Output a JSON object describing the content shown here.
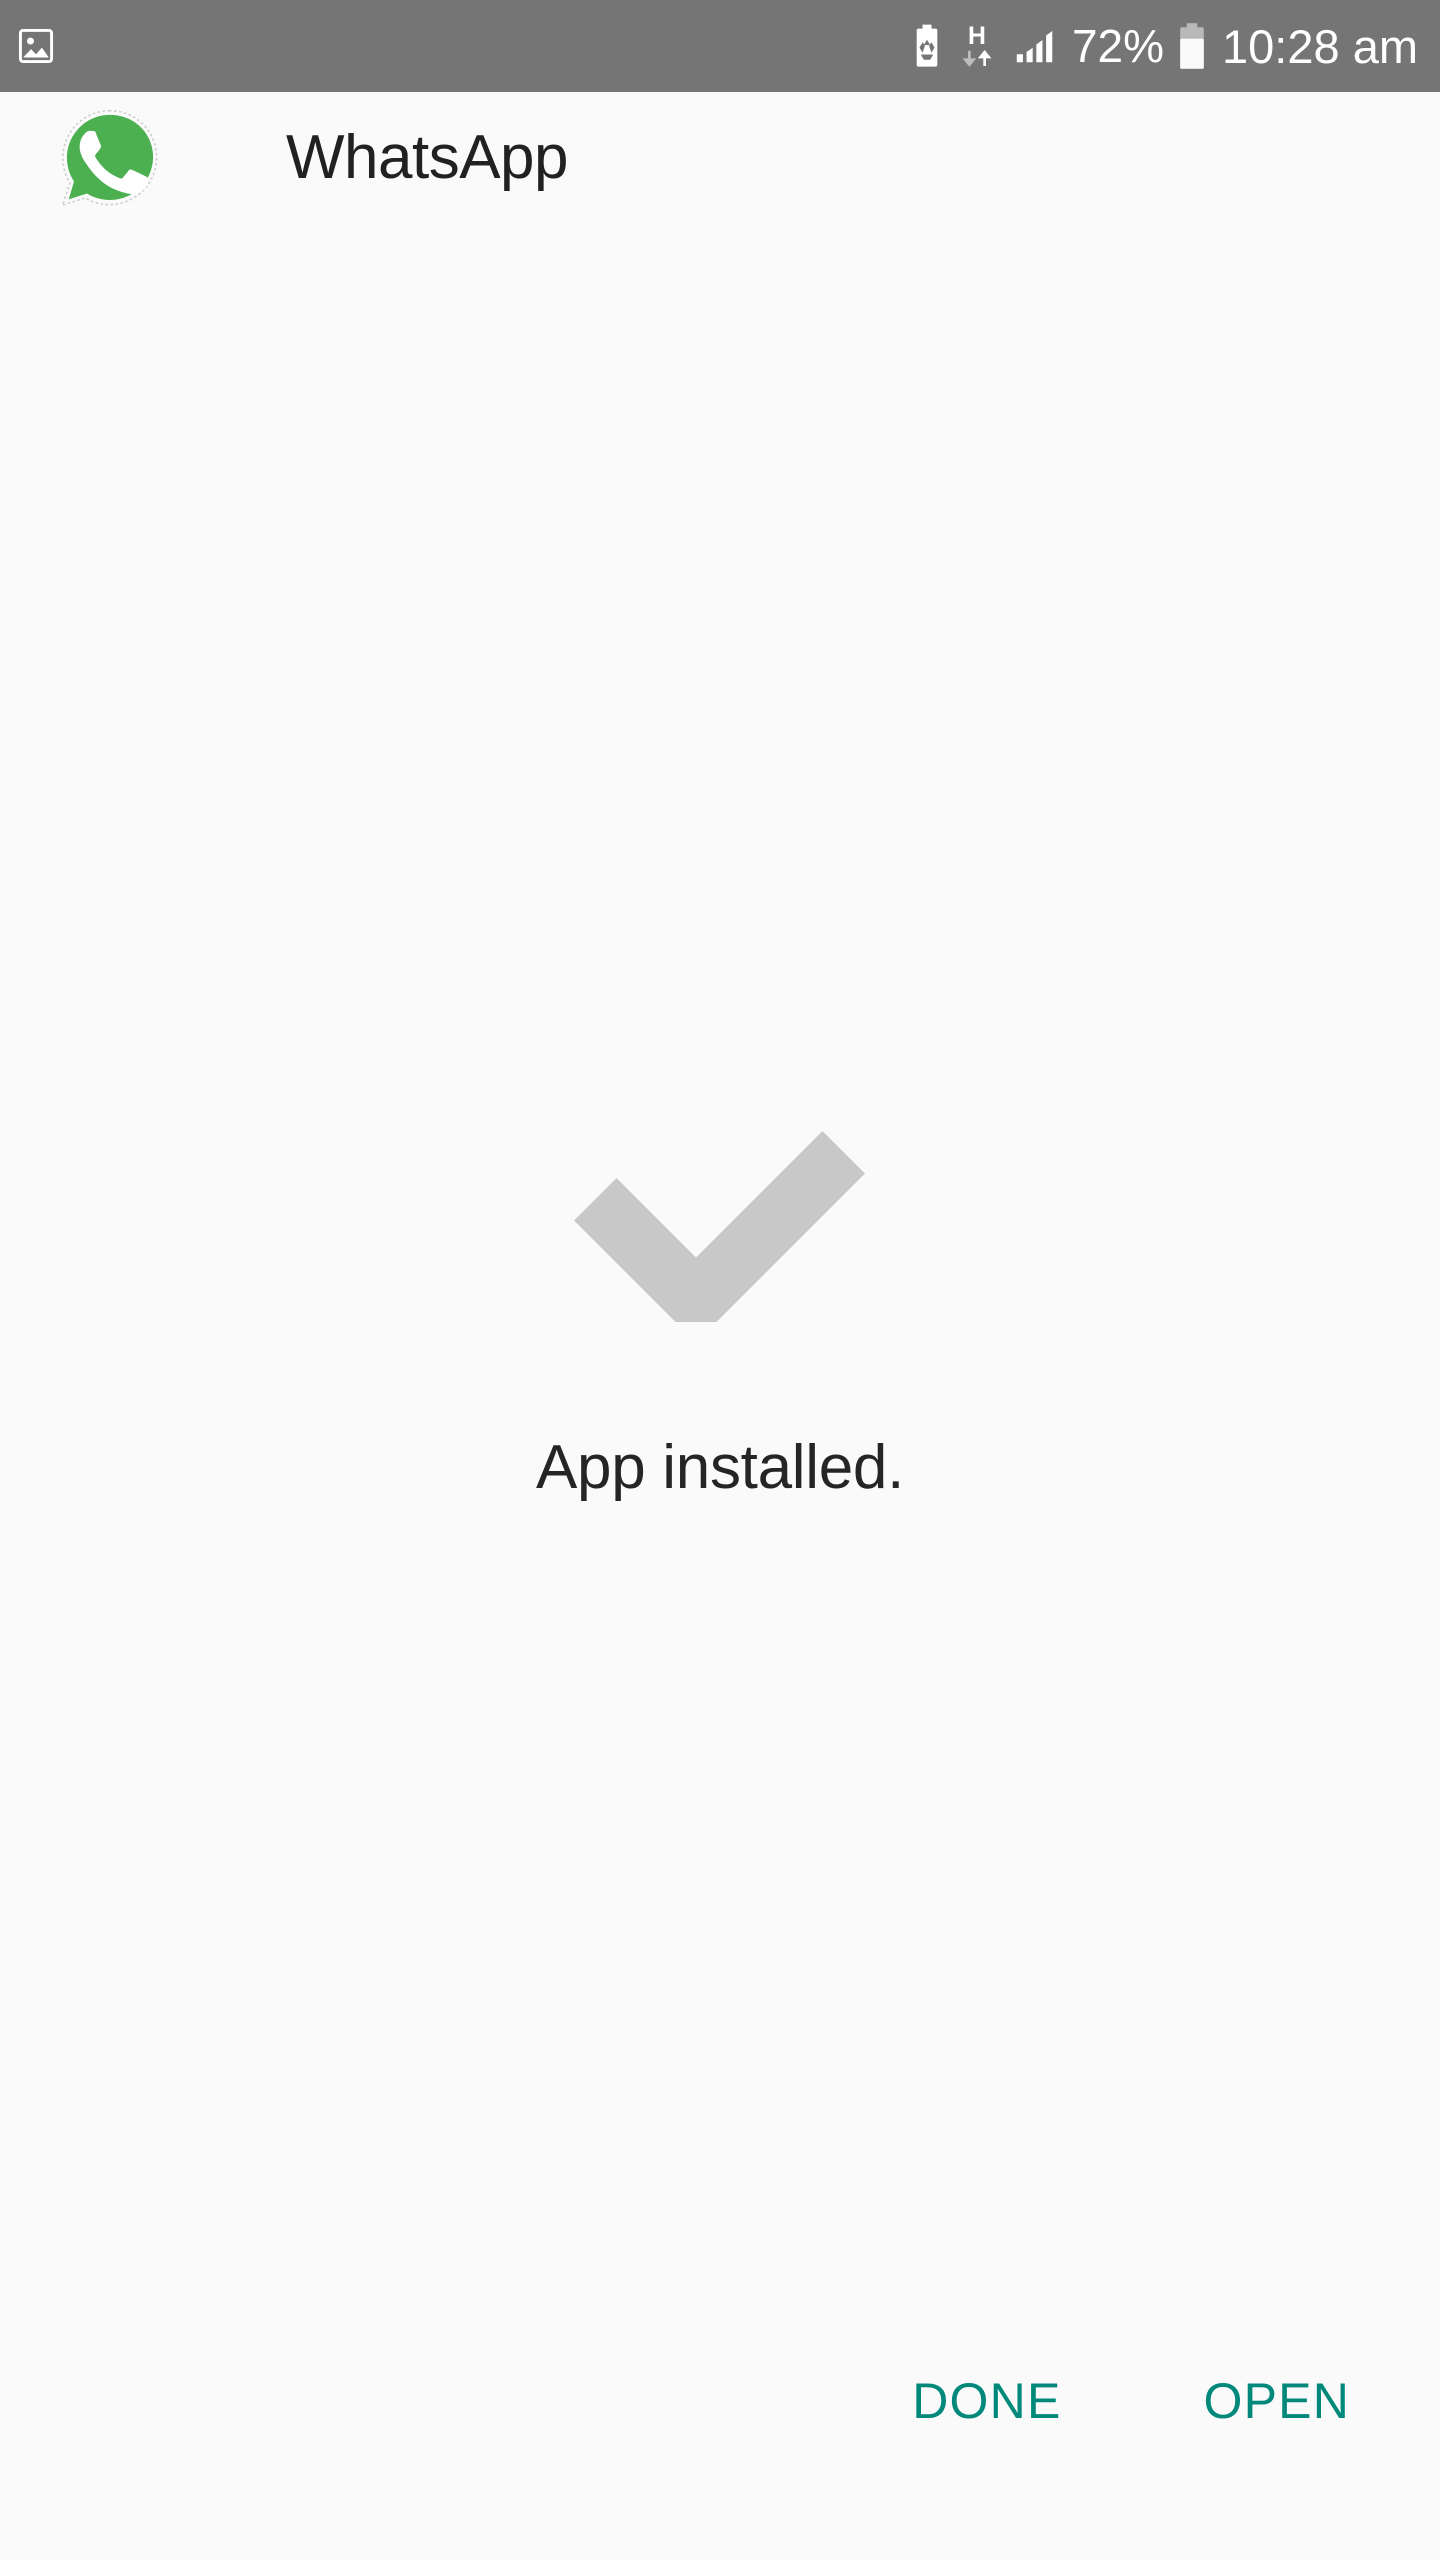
{
  "status_bar": {
    "background_color": "#757575",
    "notification_icons": [
      {
        "name": "image-notification-icon",
        "label": "Screenshot captured"
      }
    ],
    "power_saving_icon_label": "Power saving mode",
    "network_type": "H",
    "data_activity": "up-down-arrows",
    "signal_bars": 4,
    "battery_percent": "72%",
    "battery_level": 72,
    "time": "10:28 am"
  },
  "header": {
    "app_icon_name": "whatsapp-icon",
    "title": "WhatsApp",
    "icon_color": "#4CAF50"
  },
  "main": {
    "check_icon_name": "checkmark-icon",
    "check_color": "#c8c8c8",
    "message": "App installed."
  },
  "actions": {
    "accent_color": "#00897b",
    "buttons": [
      {
        "id": "done",
        "label": "DONE"
      },
      {
        "id": "open",
        "label": "OPEN"
      }
    ]
  }
}
